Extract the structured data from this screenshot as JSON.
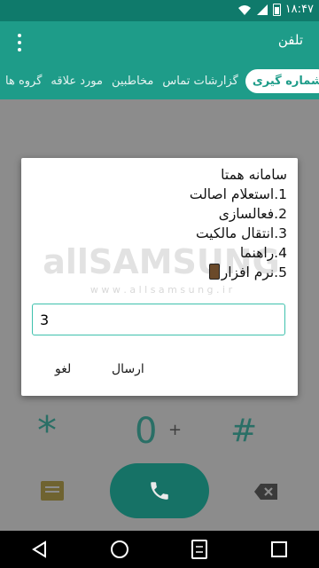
{
  "status_bar": {
    "time": "۱۸:۴۷"
  },
  "app_bar": {
    "title": "تلفن"
  },
  "tabs": [
    {
      "label": "گروه ها",
      "active": false
    },
    {
      "label": "مورد علاقه",
      "active": false
    },
    {
      "label": "مخاطبین",
      "active": false
    },
    {
      "label": "گزارشات تماس",
      "active": false
    },
    {
      "label": "شماره گیری",
      "active": true
    }
  ],
  "dialog": {
    "lines": [
      "سامانه همتا",
      "1.استعلام اصالت",
      "2.فعالسازی",
      "3.انتقال مالکیت",
      "4.راهنما",
      "5.نرم افزار"
    ],
    "watermark_logo": "allSAMSUNG",
    "watermark_url": "w w w . a l l s a m s u n g . i r",
    "input_value": "3",
    "send_label": "ارسال",
    "cancel_label": "لغو"
  },
  "dialpad": {
    "star": "*",
    "zero": "0",
    "zero_sub": "+",
    "hash": "#"
  },
  "colors": {
    "status_bar": "#0f7a6b",
    "app_bar": "#1e9c89",
    "accent": "#3ec1ad",
    "call_button": "#167266"
  },
  "icons": [
    "wifi-icon",
    "signal-icon",
    "battery-icon",
    "overflow-menu-icon",
    "message-icon",
    "phone-icon",
    "backspace-icon",
    "back-icon",
    "home-icon",
    "dual-sim-icon",
    "recents-icon"
  ]
}
